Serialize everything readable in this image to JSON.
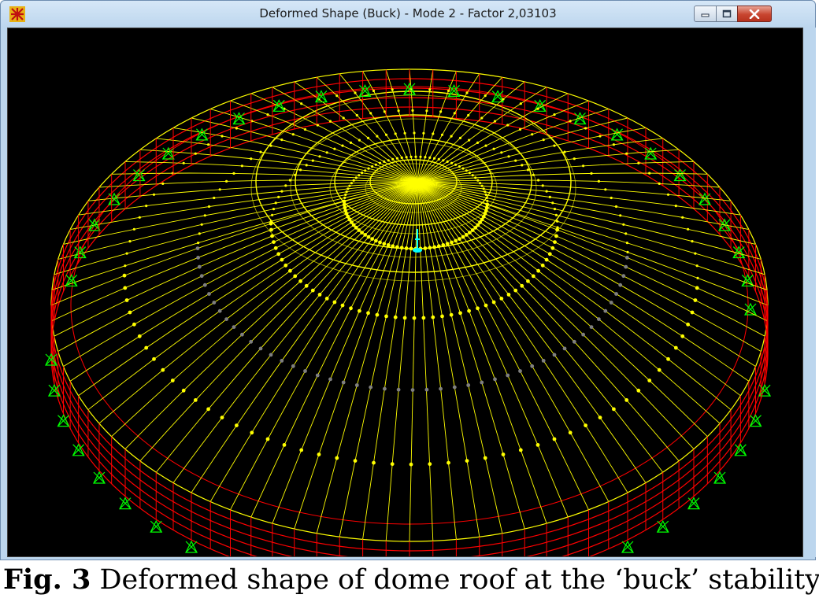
{
  "window": {
    "title": "Deformed Shape (Buck) - Mode 2 - Factor 2,03103",
    "app_icon": "sap2000-icon",
    "controls": {
      "minimize": "minimize-icon",
      "maximize": "maximize-icon",
      "close": "close-icon"
    }
  },
  "viewport": {
    "background": "#000000",
    "frame_color": "#ffff00",
    "rim_color": "#ff0000",
    "support_color": "#00ff00",
    "node_color": "#ffff00",
    "inner_node_color": "#808080",
    "joint_color": "#00ffff"
  },
  "caption": {
    "label": "Fig. 3",
    "text": " Deformed shape of dome roof at the ‘buck’ stability"
  }
}
